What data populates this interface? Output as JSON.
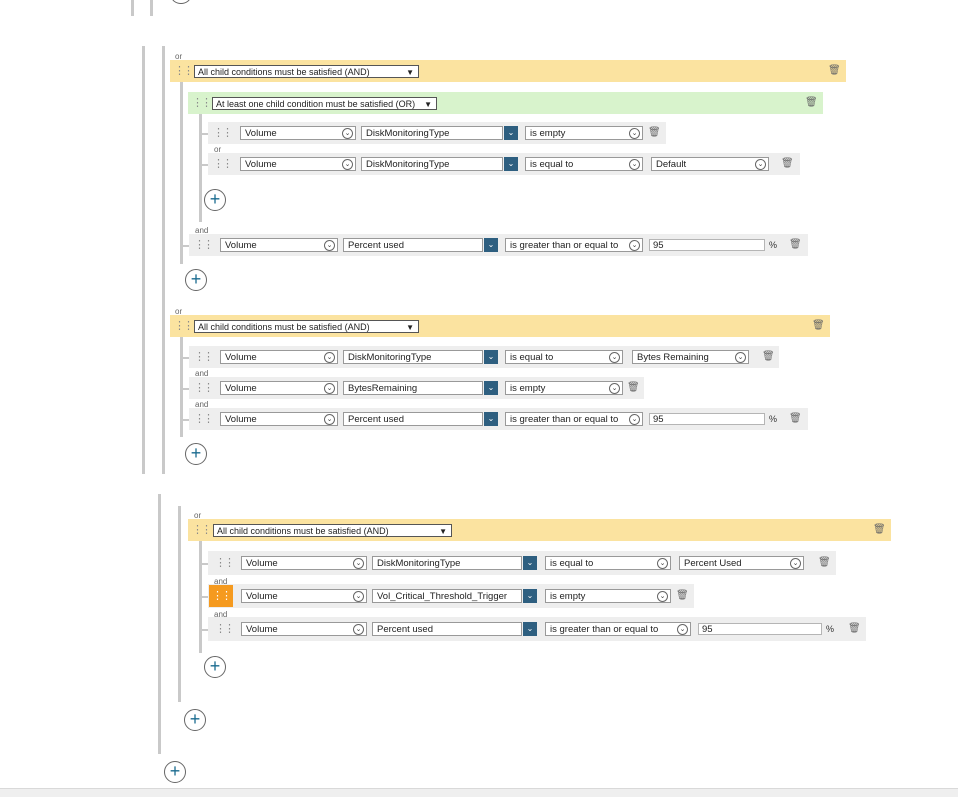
{
  "labels": {
    "or": "or",
    "and": "and",
    "pct": "%"
  },
  "group_and": "All child conditions must be satisfied (AND)",
  "group_or": "At least one child condition must be satisfied (OR)",
  "groups": [
    {
      "header": "All child conditions must be satisfied (AND)",
      "subgroup": {
        "header": "At least one child condition must be satisfied (OR)",
        "rows": [
          {
            "entity": "Volume",
            "field": "DiskMonitoringType",
            "operator": "is empty"
          },
          {
            "entity": "Volume",
            "field": "DiskMonitoringType",
            "operator": "is equal to",
            "value": "Default"
          }
        ]
      },
      "rows": [
        {
          "entity": "Volume",
          "field": "Percent used",
          "operator": "is greater than or equal to",
          "value": "95"
        }
      ]
    },
    {
      "header": "All child conditions must be satisfied (AND)",
      "rows": [
        {
          "entity": "Volume",
          "field": "DiskMonitoringType",
          "operator": "is equal to",
          "value": "Bytes Remaining"
        },
        {
          "entity": "Volume",
          "field": "BytesRemaining",
          "operator": "is empty"
        },
        {
          "entity": "Volume",
          "field": "Percent used",
          "operator": "is greater than or equal to",
          "value": "95"
        }
      ]
    },
    {
      "header": "All child conditions must be satisfied (AND)",
      "rows": [
        {
          "entity": "Volume",
          "field": "DiskMonitoringType",
          "operator": "is equal to",
          "value": "Percent Used"
        },
        {
          "entity": "Volume",
          "field": "Vol_Critical_Threshold_Trigger",
          "operator": "is empty"
        },
        {
          "entity": "Volume",
          "field": "Percent used",
          "operator": "is greater than or equal to",
          "value": "95"
        }
      ]
    }
  ],
  "icons": {
    "drag": "drag-handle-icon",
    "trash": "trash-icon",
    "add": "add-condition-icon",
    "dropdown": "chevron-down-icon"
  },
  "colors": {
    "and_group": "#fbe3a0",
    "or_group": "#d8f3cc",
    "active_handle": "#f59a1f",
    "field_button": "#2e5f80"
  }
}
